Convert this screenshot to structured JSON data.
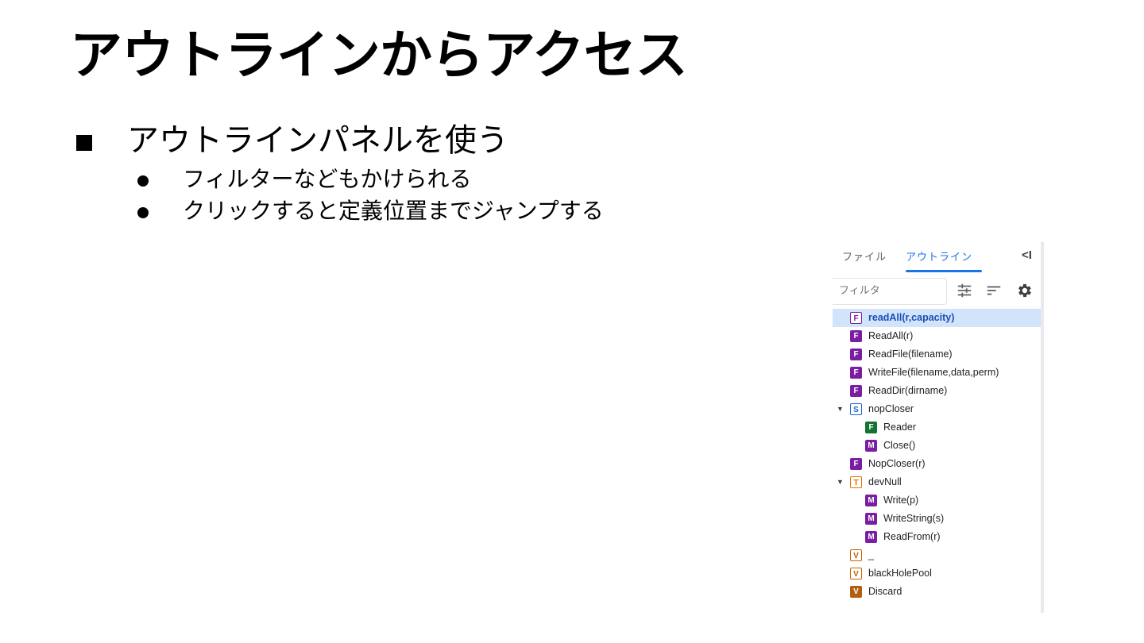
{
  "slide": {
    "title": "アウトラインからアクセス",
    "bullet": "アウトラインパネルを使う",
    "subbullets": [
      "フィルターなどもかけられる",
      "クリックすると定義位置までジャンプする"
    ]
  },
  "panel": {
    "tabs": [
      "ファイル",
      "アウトライン"
    ],
    "active_tab": "アウトライン",
    "collapse_glyph": "<I",
    "filter_placeholder": "フィルタ",
    "icons": [
      "tune-icon",
      "sort-icon",
      "gear-icon",
      "collapse-panel-icon"
    ],
    "items": [
      {
        "badge": "F",
        "label": "readAll(r,capacity)",
        "color": "#7b1fa2",
        "style": "outline",
        "selected": true
      },
      {
        "badge": "F",
        "label": "ReadAll(r)",
        "color": "#7b1fa2",
        "style": "solid"
      },
      {
        "badge": "F",
        "label": "ReadFile(filename)",
        "color": "#7b1fa2",
        "style": "solid"
      },
      {
        "badge": "F",
        "label": "WriteFile(filename,data,perm)",
        "color": "#7b1fa2",
        "style": "solid"
      },
      {
        "badge": "F",
        "label": "ReadDir(dirname)",
        "color": "#7b1fa2",
        "style": "solid"
      },
      {
        "badge": "S",
        "label": "nopCloser",
        "color": "#1967d2",
        "style": "outline",
        "expandable": true
      },
      {
        "badge": "F",
        "label": "Reader",
        "color": "#137333",
        "style": "solid",
        "child": true
      },
      {
        "badge": "M",
        "label": "Close()",
        "color": "#7b1fa2",
        "style": "solid",
        "child": true
      },
      {
        "badge": "F",
        "label": "NopCloser(r)",
        "color": "#7b1fa2",
        "style": "solid"
      },
      {
        "badge": "T",
        "label": "devNull",
        "color": "#e37400",
        "style": "outline",
        "expandable": true
      },
      {
        "badge": "M",
        "label": "Write(p)",
        "color": "#7b1fa2",
        "style": "solid",
        "child": true
      },
      {
        "badge": "M",
        "label": "WriteString(s)",
        "color": "#7b1fa2",
        "style": "solid",
        "child": true
      },
      {
        "badge": "M",
        "label": "ReadFrom(r)",
        "color": "#7b1fa2",
        "style": "solid",
        "child": true
      },
      {
        "badge": "V",
        "label": "_",
        "color": "#c26401",
        "style": "outline"
      },
      {
        "badge": "V",
        "label": "blackHolePool",
        "color": "#c26401",
        "style": "outline"
      },
      {
        "badge": "V",
        "label": "Discard",
        "color": "#b0600e",
        "style": "solid"
      }
    ]
  }
}
